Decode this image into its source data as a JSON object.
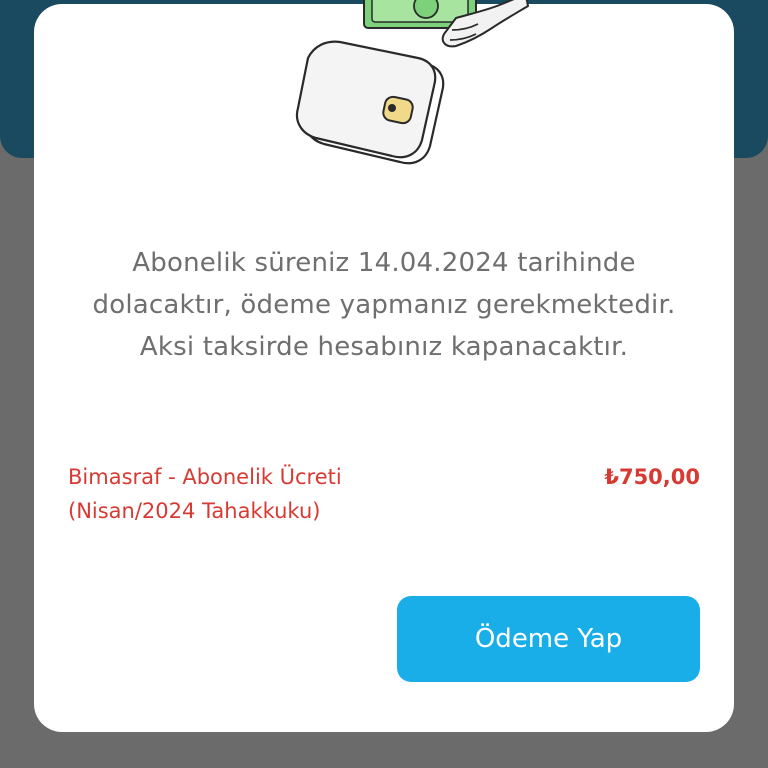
{
  "dialog": {
    "illustration_icon": "wallet-with-money-icon",
    "message": "Abonelik süreniz 14.04.2024 tarihinde dolacaktır, ödeme yapmanız gerekmektedir. Aksi taksirde hesabınız kapanacaktır.",
    "fee": {
      "label_line1": "Bimasraf - Abonelik Ücreti",
      "label_line2": "(Nisan/2024 Tahakkuku)",
      "amount": "₺750,00"
    },
    "pay_button_label": "Ödeme Yap"
  },
  "colors": {
    "header_bg": "#1a4a60",
    "overlay": "#6b6b6b",
    "fee_text": "#d63a32",
    "button_bg": "#1aaee8",
    "message_text": "#6f6f6f"
  }
}
